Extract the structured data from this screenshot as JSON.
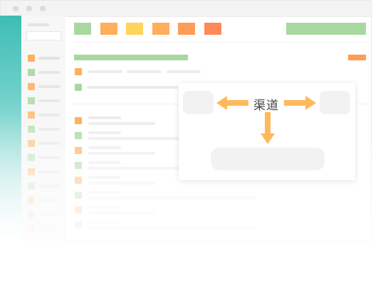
{
  "popup": {
    "label": "渠道"
  },
  "colors": {
    "green": "#a8d8a0",
    "orange": "#ffae5c",
    "yellow": "#ffd45c",
    "deep_orange": "#ff8a55",
    "teal": "#3dbdb5",
    "arrow": "#ffb95c"
  },
  "icons": {
    "arrow_left": "arrow-left-icon",
    "arrow_right": "arrow-right-icon",
    "arrow_down": "arrow-down-icon"
  }
}
